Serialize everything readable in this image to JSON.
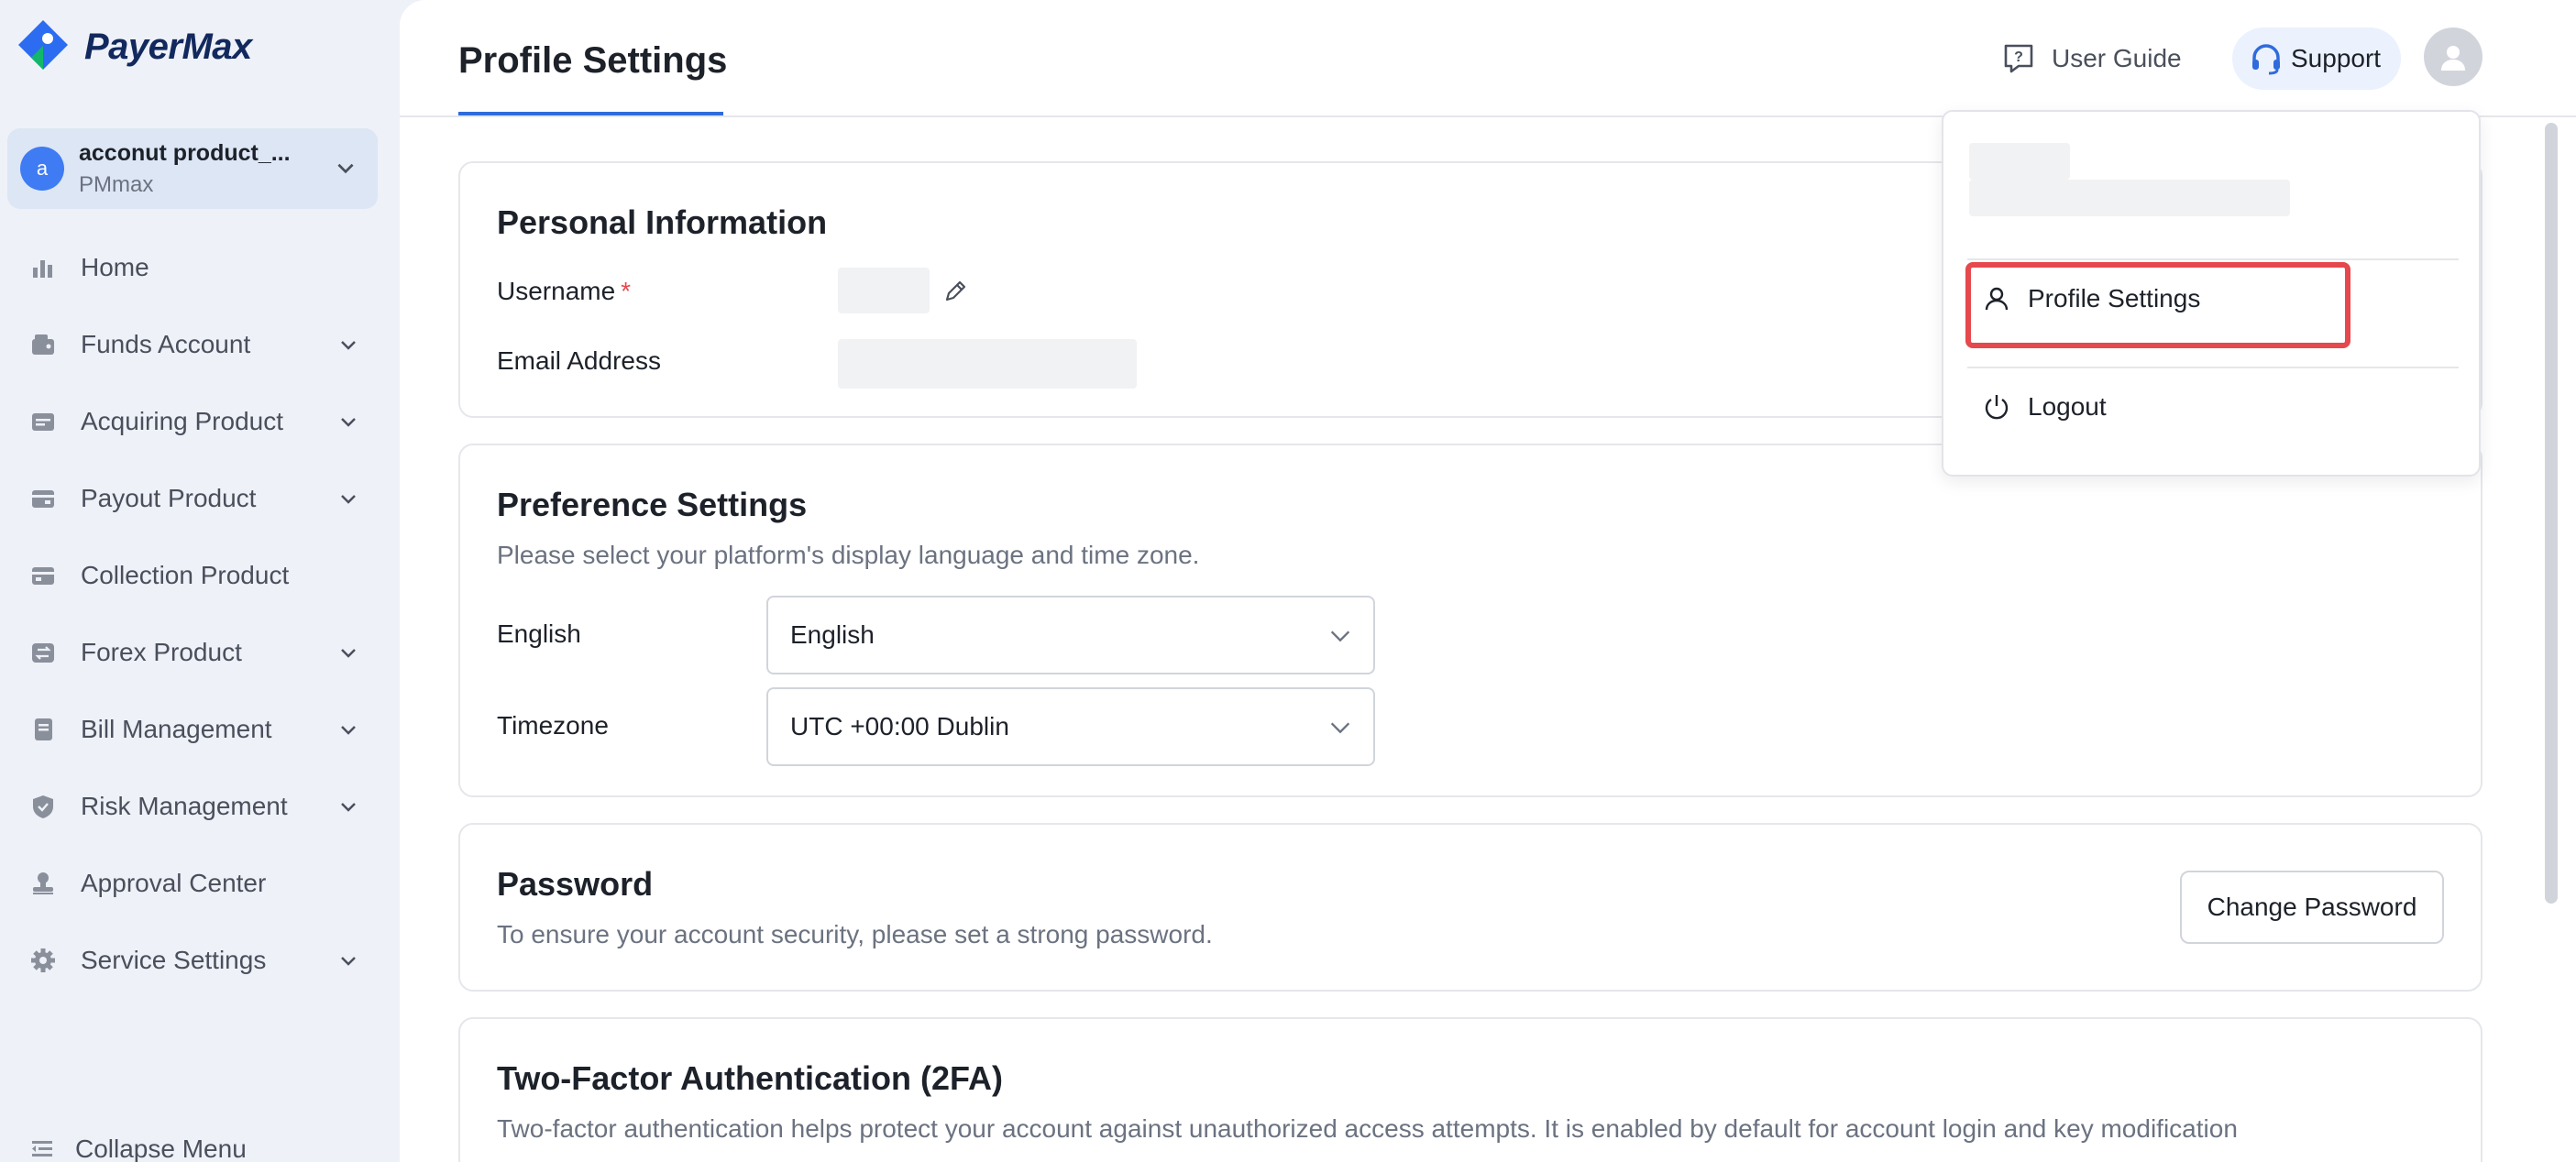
{
  "brand": {
    "name": "PayerMax"
  },
  "account": {
    "name": "acconut product_...",
    "sub": "PMmax",
    "initial": "a"
  },
  "nav": {
    "items": [
      {
        "label": "Home",
        "icon": "bar-chart-icon",
        "expandable": false
      },
      {
        "label": "Funds Account",
        "icon": "wallet-icon",
        "expandable": true
      },
      {
        "label": "Acquiring Product",
        "icon": "card-icon",
        "expandable": true
      },
      {
        "label": "Payout Product",
        "icon": "payout-icon",
        "expandable": true
      },
      {
        "label": "Collection Product",
        "icon": "collection-icon",
        "expandable": false
      },
      {
        "label": "Forex Product",
        "icon": "exchange-icon",
        "expandable": true
      },
      {
        "label": "Bill Management",
        "icon": "bill-icon",
        "expandable": true
      },
      {
        "label": "Risk Management",
        "icon": "shield-icon",
        "expandable": true
      },
      {
        "label": "Approval Center",
        "icon": "stamp-icon",
        "expandable": false
      },
      {
        "label": "Service Settings",
        "icon": "gear-icon",
        "expandable": true
      }
    ],
    "collapse_label": "Collapse Menu"
  },
  "header": {
    "title": "Profile Settings",
    "user_guide": "User Guide",
    "support": "Support"
  },
  "personal": {
    "title": "Personal Information",
    "username_label": "Username",
    "required_mark": "*",
    "email_label": "Email Address"
  },
  "preference": {
    "title": "Preference Settings",
    "desc": "Please select your platform's display language and time zone.",
    "language_label": "English",
    "language_value": "English",
    "timezone_label": "Timezone",
    "timezone_value": "UTC +00:00 Dublin"
  },
  "password": {
    "title": "Password",
    "desc": "To ensure your account security, please set a strong password.",
    "button": "Change Password"
  },
  "twofa": {
    "title": "Two-Factor Authentication (2FA)",
    "desc": "Two-factor authentication helps protect your account against unauthorized access attempts. It is enabled by default for account login and key modification"
  },
  "dropdown": {
    "profile_settings": "Profile Settings",
    "logout": "Logout"
  },
  "colors": {
    "accent": "#2f6bdc",
    "highlight": "#e5484d",
    "sidebar_bg": "#eef1f7"
  }
}
